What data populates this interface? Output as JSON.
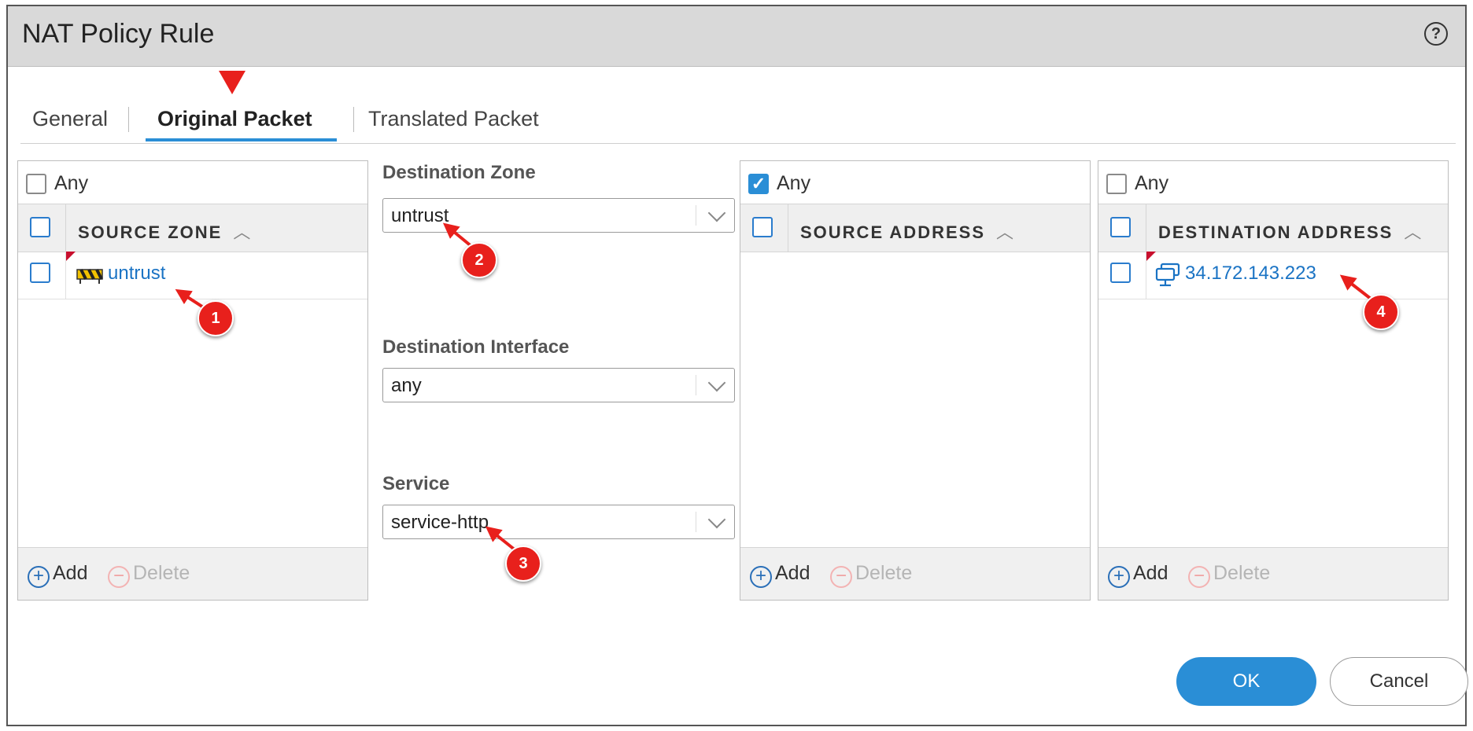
{
  "dialog": {
    "title": "NAT Policy Rule",
    "help_icon": "?"
  },
  "tabs": [
    {
      "label": "General",
      "active": false
    },
    {
      "label": "Original Packet",
      "active": true
    },
    {
      "label": "Translated Packet",
      "active": false
    }
  ],
  "source_zone": {
    "any_label": "Any",
    "any_checked": false,
    "header": "SOURCE ZONE",
    "rows": [
      {
        "value": "untrust",
        "icon": "zone-icon"
      }
    ],
    "add_label": "Add",
    "delete_label": "Delete"
  },
  "destination": {
    "zone_label": "Destination Zone",
    "zone_value": "untrust",
    "interface_label": "Destination Interface",
    "interface_value": "any",
    "service_label": "Service",
    "service_value": "service-http"
  },
  "source_address": {
    "any_label": "Any",
    "any_checked": true,
    "header": "SOURCE ADDRESS",
    "rows": [],
    "add_label": "Add",
    "delete_label": "Delete"
  },
  "destination_address": {
    "any_label": "Any",
    "any_checked": false,
    "header": "DESTINATION ADDRESS",
    "rows": [
      {
        "value": "34.172.143.223",
        "icon": "address-object-icon"
      }
    ],
    "add_label": "Add",
    "delete_label": "Delete"
  },
  "annotations": [
    "1",
    "2",
    "3",
    "4"
  ],
  "buttons": {
    "ok_label": "OK",
    "cancel_label": "Cancel"
  },
  "colors": {
    "accent": "#2a8ed6",
    "link": "#1a73c4",
    "annotation_red": "#e8201c",
    "title_bar": "#d9d9d9"
  }
}
